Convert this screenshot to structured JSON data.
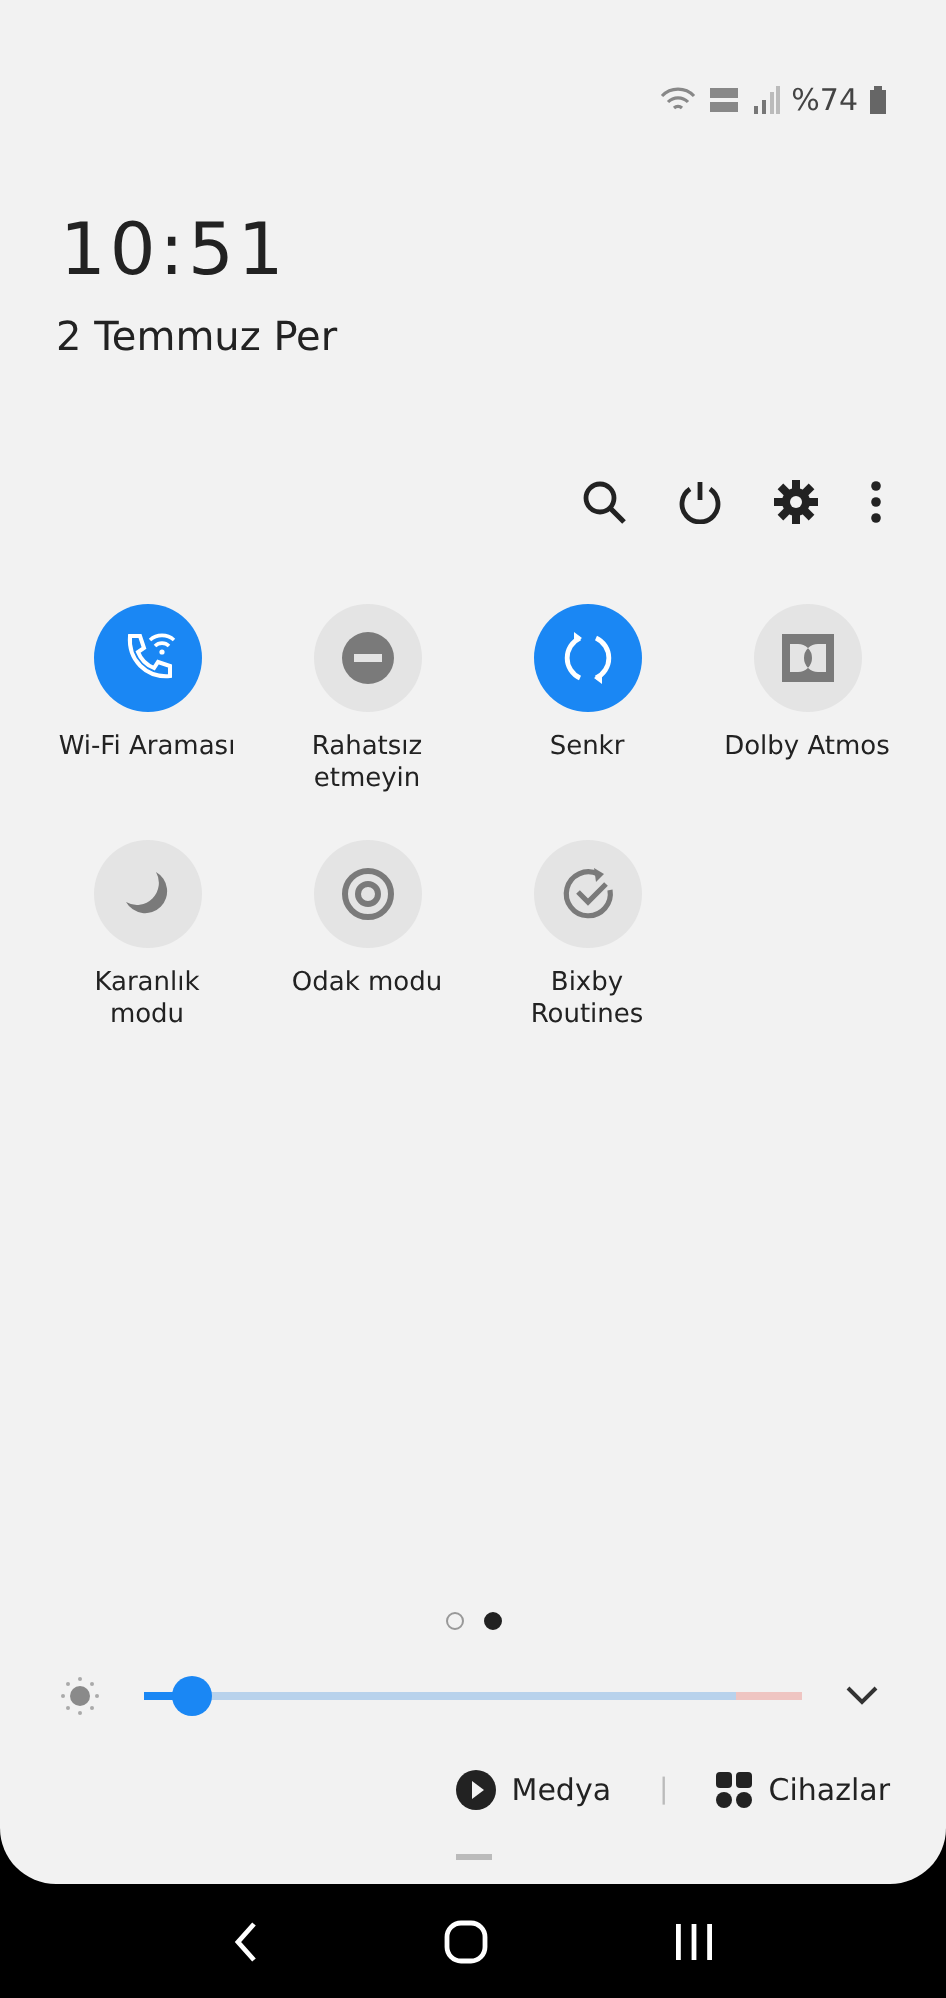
{
  "status_bar": {
    "battery": "%74"
  },
  "clock": {
    "time": "10:51",
    "date": "2 Temmuz Per"
  },
  "tiles": [
    {
      "label": "Wi-Fi Araması",
      "kind": "call",
      "on": true
    },
    {
      "label": "Rahatsız etmeyin",
      "kind": "dnd",
      "on": false
    },
    {
      "label": "Senkr",
      "kind": "sync",
      "on": true
    },
    {
      "label": "Dolby Atmos",
      "kind": "audio",
      "on": false
    },
    {
      "label": "Karanlık modu",
      "kind": "dark",
      "on": false
    },
    {
      "label": "Odak modu",
      "kind": "focus",
      "on": false
    },
    {
      "label": "Bixby Routines",
      "kind": "routine",
      "on": false
    }
  ],
  "pages": [
    {
      "selected": false
    },
    {
      "selected": true
    }
  ],
  "brightness": {
    "level": 0.05
  },
  "media_row": {
    "media": "Medya",
    "divider": "|",
    "devices": "Cihazlar"
  }
}
